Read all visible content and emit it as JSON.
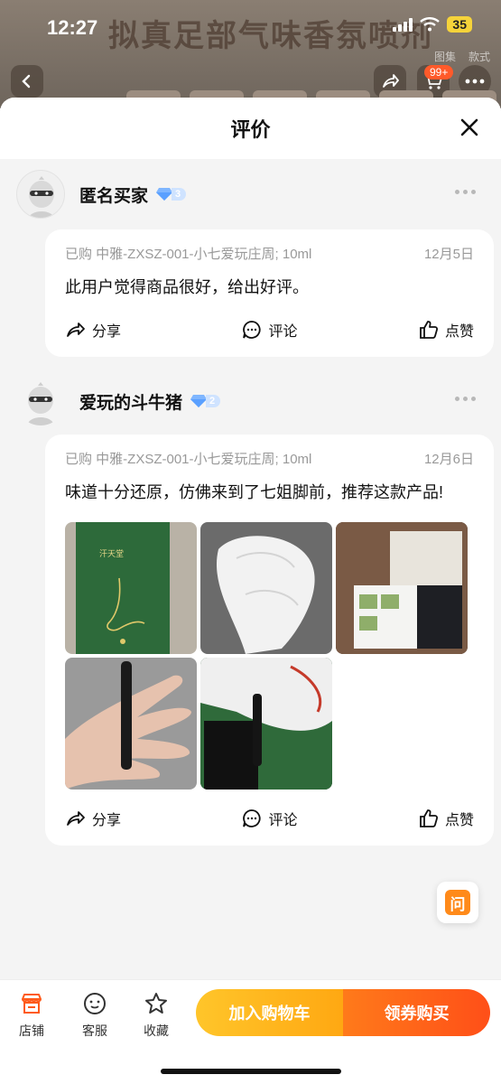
{
  "status_bar": {
    "time": "12:27",
    "battery": "35"
  },
  "background_page": {
    "title": "拟真足部气味香氛喷剂",
    "tabs": [
      "图集",
      "款式"
    ],
    "cart_badge": "99+"
  },
  "sheet": {
    "title": "评价"
  },
  "reviews": [
    {
      "username": "匿名买家",
      "level": "3",
      "purchased": "已购 中雅-ZXSZ-001-小七爱玩庄周; 10ml",
      "date": "12月5日",
      "content": "此用户觉得商品很好，给出好评。",
      "photos": []
    },
    {
      "username": "爱玩的斗牛猪",
      "level": "2",
      "purchased": "已购 中雅-ZXSZ-001-小七爱玩庄周; 10ml",
      "date": "12月6日",
      "content": "味道十分还原，仿佛来到了七姐脚前，推荐这款产品!",
      "photos": [
        "green-foot-card",
        "white-socks",
        "sample-cards",
        "hand-with-vial",
        "socks-with-vial"
      ],
      "photo_card_text": "汗天堂"
    }
  ],
  "actions": {
    "share": "分享",
    "comment": "评论",
    "like": "点赞"
  },
  "ask_button": "问",
  "bottom_bar": {
    "store": "店铺",
    "service": "客服",
    "favorite": "收藏",
    "add_to_cart": "加入购物车",
    "buy": "领券购买"
  },
  "colors": {
    "accent_orange": "#ff5a1a",
    "cart_yellow": "#ffb21e",
    "level_blue": "#9fc8ff"
  }
}
